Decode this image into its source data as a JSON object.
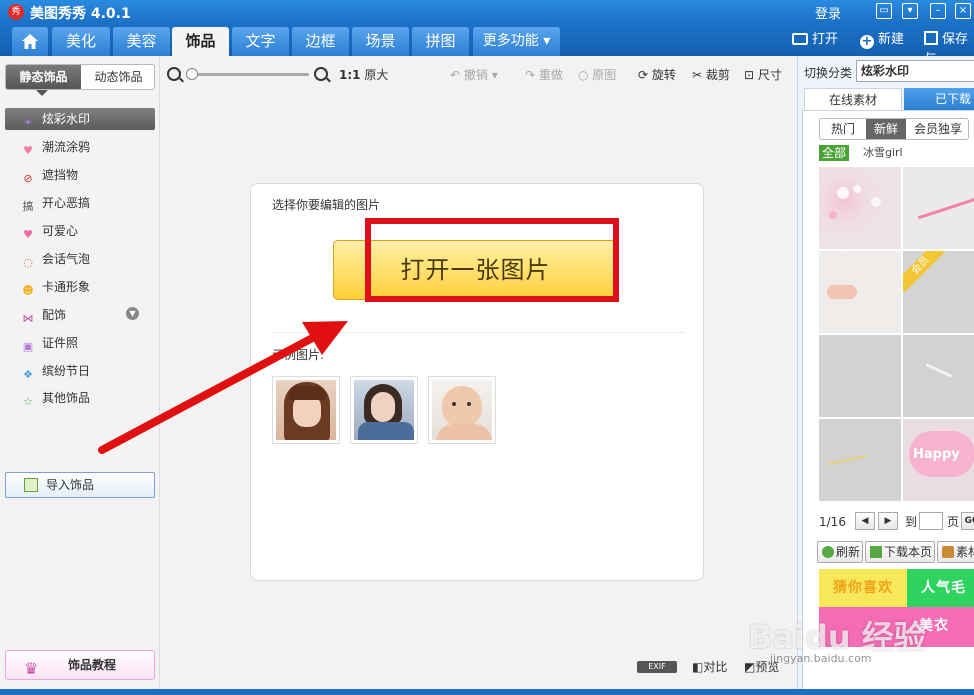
{
  "app": {
    "logo_text": "秀",
    "title": "美图秀秀 4.0.1",
    "login": "登录"
  },
  "menu": {
    "tabs": [
      "美化",
      "美容",
      "饰品",
      "文字",
      "边框",
      "场景",
      "拼图",
      "更多功能 ▾"
    ],
    "active_tab": "饰品",
    "right_actions": {
      "open": "打开",
      "new": "新建",
      "save": "保存与"
    }
  },
  "left_panel": {
    "switch_static": "静态饰品",
    "switch_dynamic": "动态饰品",
    "categories": [
      {
        "label": "炫彩水印",
        "icon": "sparkle-icon",
        "color": "#9b7bd6",
        "glyph": "✦"
      },
      {
        "label": "潮流涂鸦",
        "icon": "lips-icon",
        "color": "#f47aa8",
        "glyph": "♥"
      },
      {
        "label": "遮挡物",
        "icon": "no-sign-icon",
        "color": "#d9342b",
        "glyph": "⊘"
      },
      {
        "label": "开心恶搞",
        "icon": "prank-icon",
        "color": "#555555",
        "glyph": "搞"
      },
      {
        "label": "可爱心",
        "icon": "heart-icon",
        "color": "#f06aa0",
        "glyph": "♥"
      },
      {
        "label": "会话气泡",
        "icon": "speech-bubble-icon",
        "color": "#e5554a",
        "glyph": "◌"
      },
      {
        "label": "卡通形象",
        "icon": "cartoon-face-icon",
        "color": "#f5b120",
        "glyph": "☻"
      },
      {
        "label": "配饰",
        "icon": "bow-icon",
        "color": "#c94da8",
        "glyph": "⋈"
      },
      {
        "label": "证件照",
        "icon": "shirt-icon",
        "color": "#b57ad9",
        "glyph": "▣"
      },
      {
        "label": "缤纷节日",
        "icon": "gift-icon",
        "color": "#46a0e0",
        "glyph": "❖"
      },
      {
        "label": "其他饰品",
        "icon": "star-outline-icon",
        "color": "#52a85a",
        "glyph": "☆"
      }
    ],
    "selected_category": "炫彩水印",
    "import_label": "导入饰品",
    "tutorial_label": "饰品教程"
  },
  "toolbar": {
    "ratio_label": "1:1",
    "original_size": "原大",
    "undo": "撤销",
    "redo": "重做",
    "original": "原图",
    "rotate": "旋转",
    "crop": "裁剪",
    "resize": "尺寸"
  },
  "canvas": {
    "prompt": "选择你要编辑的图片",
    "open_button": "打开一张图片",
    "samples_label": "示例图片:",
    "samples": [
      "sample-portrait-1",
      "sample-portrait-2",
      "sample-baby"
    ]
  },
  "status": {
    "exif": "EXIF",
    "compare": "对比",
    "preview": "预览"
  },
  "right_panel": {
    "switch_label": "切换分类",
    "select_value": "炫彩水印",
    "tab_online": "在线素材",
    "tab_downloaded": "已下载",
    "subtabs": [
      "热门",
      "新鲜",
      "会员独享"
    ],
    "active_subtab": "新鲜",
    "tag_all": "全部",
    "tag_name": "冰雪girl",
    "member_badge": "会员",
    "happy_text": "Happy",
    "pager_text": "1/16",
    "goto_label": "到",
    "page_unit": "页",
    "go_label": "GO",
    "refresh": "刷新",
    "download_page": "下载本页",
    "material": "素材",
    "banner_left": "猜你喜欢",
    "banner_right": "人气毛",
    "banner_bottom": "美衣"
  },
  "watermark": {
    "text": "Baidu 经验",
    "sub": "jingyan.baidu.com"
  },
  "colors": {
    "titlebar": "#1b6fc4",
    "highlight": "#e0101a",
    "open_button": "#ffcf38"
  }
}
